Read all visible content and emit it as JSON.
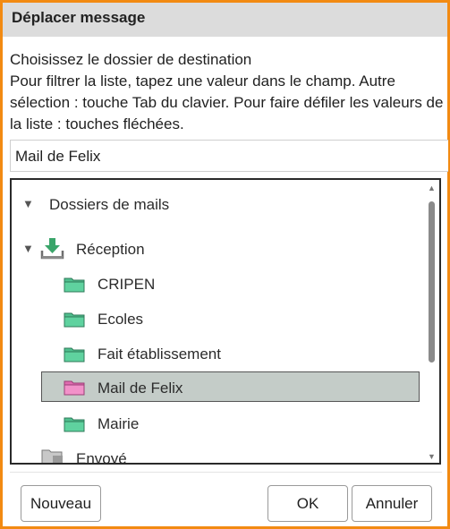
{
  "dialog": {
    "title": "Déplacer message",
    "description": "Choisissez le dossier de destination\nPour filtrer la liste, tapez une valeur dans le champ. Autre sélection : touche Tab du clavier. Pour faire défiler les valeurs de la liste : touches fléchées.",
    "filter_value": "Mail de Felix"
  },
  "tree": {
    "root_label": "Dossiers de mails",
    "inbox_label": "Réception",
    "folders": [
      {
        "label": "CRIPEN"
      },
      {
        "label": "Ecoles"
      },
      {
        "label": "Fait établissement"
      },
      {
        "label": "Mail de Felix",
        "selected": true
      },
      {
        "label": "Mairie"
      }
    ],
    "sent_label": "Envoyé",
    "colors": {
      "folder": "#4fbf8e",
      "folder_selected": "#e06bb0",
      "selection_bg": "#c4ccc8"
    }
  },
  "buttons": {
    "new": "Nouveau",
    "ok": "OK",
    "cancel": "Annuler"
  },
  "accent_color": "#f28a12"
}
